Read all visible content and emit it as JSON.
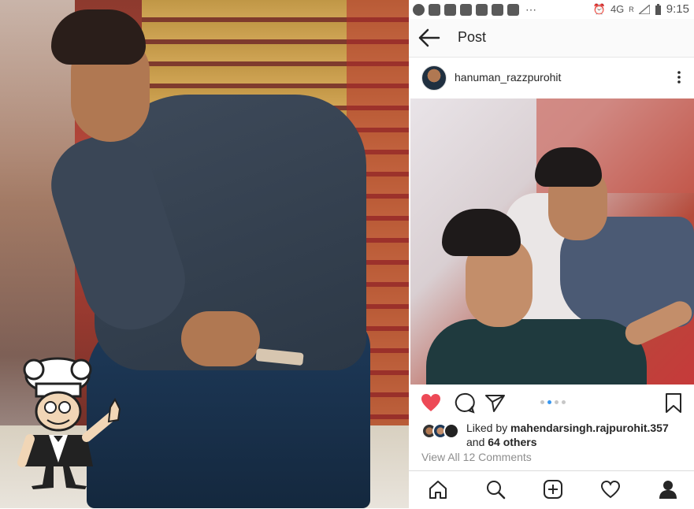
{
  "status_bar": {
    "network": "4G",
    "signal_r": "R",
    "time": "9:15"
  },
  "app_bar": {
    "title": "Post"
  },
  "post": {
    "username": "hanuman_razzpurohit",
    "liked_by_prefix": "Liked by ",
    "liked_by_user": "mahendarsingh.rajpurohit.357",
    "and_text": "and ",
    "others": "64 others",
    "view_comments": "View All 12 Comments",
    "carousel": {
      "count": 4,
      "active_index": 1
    }
  },
  "colors": {
    "heart": "#ed4956",
    "link_blue": "#3897f0",
    "text": "#262626",
    "muted": "#8e8e8e"
  },
  "icons": {
    "back": "arrow-left-icon",
    "more": "more-vertical-icon",
    "like": "heart-filled-icon",
    "comment": "comment-icon",
    "share": "send-icon",
    "save": "bookmark-icon",
    "nav": [
      "home-icon",
      "search-icon",
      "new-post-icon",
      "activity-heart-icon",
      "profile-icon"
    ]
  }
}
